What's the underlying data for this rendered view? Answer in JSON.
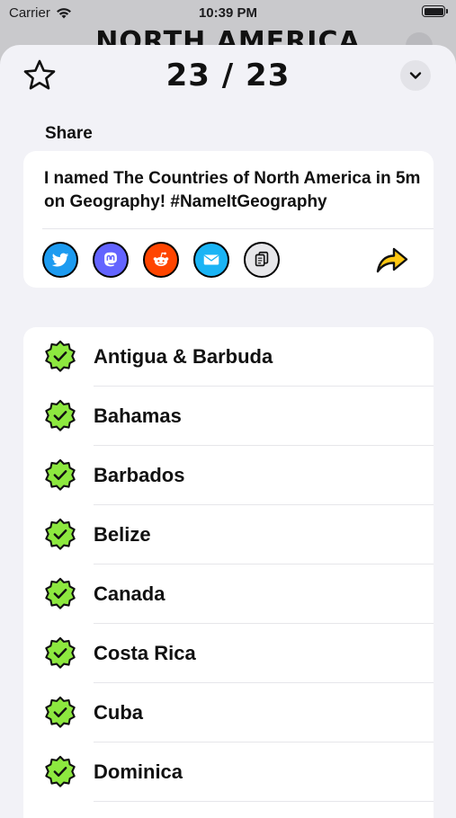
{
  "status_bar": {
    "carrier": "Carrier",
    "time": "10:39 PM"
  },
  "background": {
    "title": "NORTH AMERICA"
  },
  "header": {
    "score": "23 / 23"
  },
  "share": {
    "label": "Share",
    "message": "I named The Countries of North America in 5m on Geography! #NameItGeography",
    "buttons": [
      "twitter-icon",
      "mastodon-icon",
      "reddit-icon",
      "mail-icon",
      "copy-icon",
      "share-arrow-icon"
    ]
  },
  "countries": [
    {
      "name": "Antigua & Barbuda",
      "status": "correct"
    },
    {
      "name": "Bahamas",
      "status": "correct"
    },
    {
      "name": "Barbados",
      "status": "correct"
    },
    {
      "name": "Belize",
      "status": "correct"
    },
    {
      "name": "Canada",
      "status": "correct"
    },
    {
      "name": "Costa Rica",
      "status": "correct"
    },
    {
      "name": "Cuba",
      "status": "correct"
    },
    {
      "name": "Dominica",
      "status": "correct"
    }
  ],
  "colors": {
    "check_badge": "#8de83f",
    "share_arrow": "#ffc712",
    "twitter": "#1d9bf0",
    "mastodon": "#6364ff",
    "reddit": "#ff4500",
    "mail": "#1ab4f5",
    "sheet_bg": "#f2f2f7"
  }
}
